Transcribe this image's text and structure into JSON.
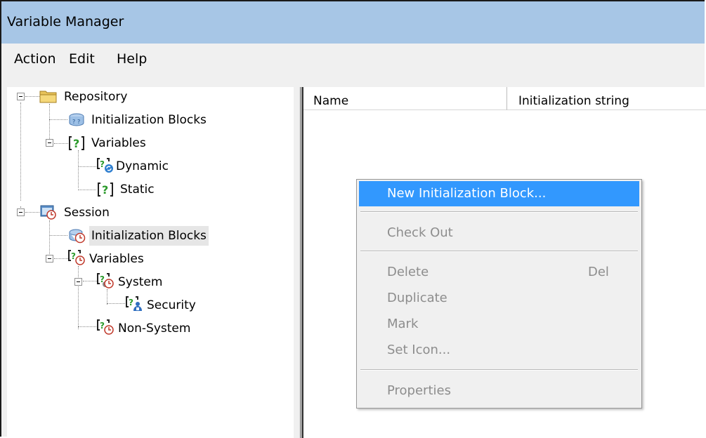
{
  "window": {
    "title": "Variable Manager"
  },
  "menubar": {
    "items": [
      "Action",
      "Edit",
      "Help"
    ]
  },
  "tree": {
    "items": [
      {
        "label": "Repository",
        "icon": "folder-icon"
      },
      {
        "label": "Initialization Blocks",
        "icon": "init-blocks-icon"
      },
      {
        "label": "Variables",
        "icon": "variables-icon"
      },
      {
        "label": "Dynamic",
        "icon": "dynamic-variable-icon"
      },
      {
        "label": "Static",
        "icon": "static-variable-icon"
      },
      {
        "label": "Session",
        "icon": "session-icon"
      },
      {
        "label": "Initialization Blocks",
        "icon": "session-init-blocks-icon",
        "selected": true
      },
      {
        "label": "Variables",
        "icon": "session-variables-icon"
      },
      {
        "label": "System",
        "icon": "system-variable-icon"
      },
      {
        "label": "Security",
        "icon": "security-variable-icon"
      },
      {
        "label": "Non-System",
        "icon": "non-system-variable-icon"
      }
    ]
  },
  "list": {
    "columns": [
      "Name",
      "Initialization string"
    ]
  },
  "context_menu": {
    "new_init_block": "New Initialization Block...",
    "check_out": "Check Out",
    "delete": "Delete",
    "delete_shortcut": "Del",
    "duplicate": "Duplicate",
    "mark": "Mark",
    "set_icon": "Set Icon...",
    "properties": "Properties"
  },
  "colors": {
    "titlebar": "#a7c6e6",
    "menu_highlight": "#3298fe",
    "disabled_text": "#8d8d8d",
    "question_green": "#2b9a2b",
    "clock_red": "#c0392b"
  }
}
